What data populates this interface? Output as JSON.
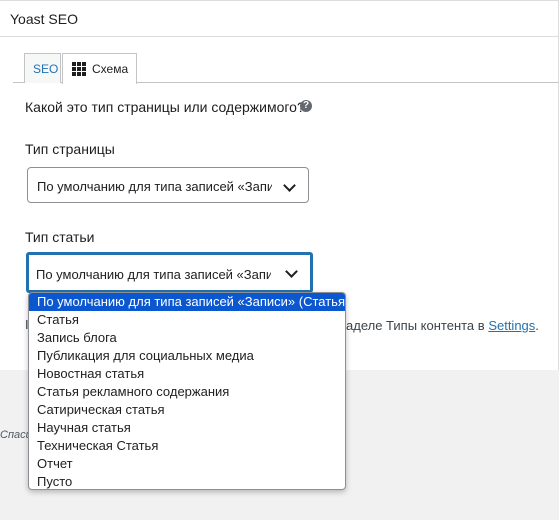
{
  "panel": {
    "title": "Yoast SEO"
  },
  "tabs": [
    {
      "label": "SEO"
    },
    {
      "label": "Схема"
    }
  ],
  "question": "Какой это тип страницы или содержимого?",
  "page_type": {
    "label": "Тип страницы",
    "value": "По умолчанию для типа записей «Записи» (Веб-страница)"
  },
  "article_type": {
    "label": "Тип статьи",
    "value": "По умолчанию для типа записей «Записи» (Статья)"
  },
  "hint": {
    "prefix": "I",
    "suffix": "аделе Типы контента в",
    "link": "Settings",
    "period": "."
  },
  "footer": {
    "text": "Спаси"
  },
  "dropdown": {
    "options": [
      "По умолчанию для типа записей «Записи» (Статья)",
      "Статья",
      "Запись блога",
      "Публикация для социальных медиа",
      "Новостная статья",
      "Статья рекламного содержания",
      "Сатирическая статья",
      "Научная статья",
      "Техническая Статья",
      "Отчет",
      "Пусто"
    ],
    "selected_index": 0
  },
  "colors": {
    "accent": "#2271b1",
    "selection": "#0b57d0"
  }
}
